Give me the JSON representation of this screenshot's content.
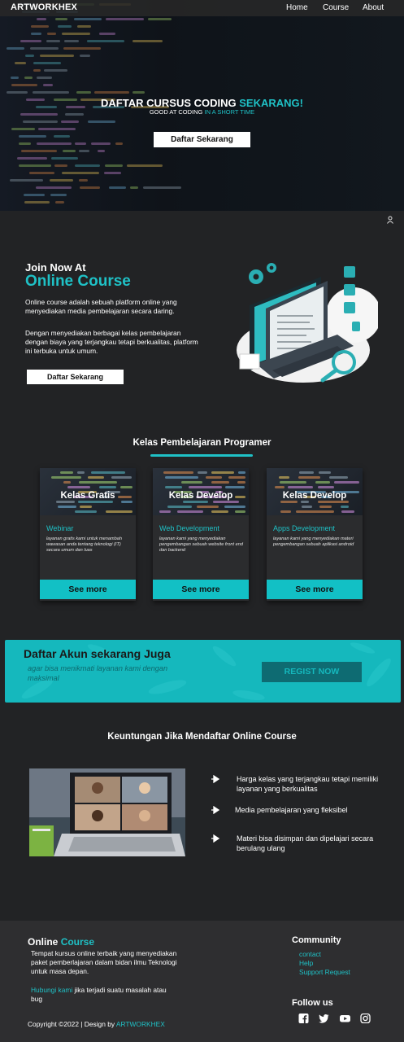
{
  "nav": {
    "brand": "ARTWORKHEX",
    "links": [
      "Home",
      "Course",
      "About"
    ]
  },
  "hero": {
    "title_part1": "DAFTAR CURSUS CODING ",
    "title_part2": "SEKARANG!",
    "subtitle_part1": "GOOD AT CODING ",
    "subtitle_part2": "IN A SHORT TIME",
    "button": "Daftar Sekarang"
  },
  "join": {
    "pre_title": "Join Now At",
    "title": "Online Course",
    "paragraph1": "Online course adalah sebuah platform online yang menyediakan media pembelajaran secara daring.",
    "paragraph2": "Dengan menyediakan berbagai kelas pembelajaran dengan biaya yang terjangkau tetapi berkualitas, platform ini terbuka untuk umum.",
    "button": "Daftar Sekarang"
  },
  "classes": {
    "title": "Kelas Pembelajaran Programer",
    "cards": [
      {
        "heading": "Kelas Gratis",
        "subtitle": "Webinar",
        "description": "layanan gratis kami untuk menambah wawasan anda tentang teknologi (IT) secara umum dan luas",
        "button": "See more"
      },
      {
        "heading": "Kelas Develop",
        "subtitle": "Web Development",
        "description": "layanan kami yang menyediakan pengembangan sebuah website front end dan backend",
        "button": "See more"
      },
      {
        "heading": "Kelas Develop",
        "subtitle": "Apps Development",
        "description": "layanan kami yang menyediakan materi pengembangan sebuah aplikasi android",
        "button": "See more"
      }
    ]
  },
  "register": {
    "title": "Daftar Akun sekarang Juga",
    "subtitle": "agar bisa menikmati layanan kami dengan maksimal",
    "button": "REGIST NOW"
  },
  "benefits": {
    "title": "Keuntungan Jika Mendaftar Online Course",
    "items": [
      "Harga kelas yang terjangkau tetapi memiliki layanan yang berkualitas",
      "Media pembelajaran yang fleksibel",
      "Materi bisa disimpan dan dipelajari secara berulang ulang"
    ]
  },
  "footer": {
    "brand_part1": "Online",
    "brand_part2": "Course",
    "description": "Tempat kursus online terbaik yang menyediakan paket pemberlajaran dalam bidan ilmu Teknologi untuk masa depan.",
    "help_link": "Hubungi kami",
    "help_text": " jika terjadi suatu masalah atau bug",
    "copyright": "Copyright ©2022  |  Design by ",
    "designer": "ARTWORKHEX",
    "community_title": "Community",
    "community_links": [
      "contact",
      "Help",
      "Support Request"
    ],
    "follow_title": "Follow us",
    "social_icons": [
      "facebook-icon",
      "twitter-icon",
      "youtube-icon",
      "instagram-icon"
    ]
  },
  "colors": {
    "accent": "#1fc1c6",
    "background": "#222325",
    "footer": "#2e2e30",
    "banner": "#15b8bd"
  }
}
